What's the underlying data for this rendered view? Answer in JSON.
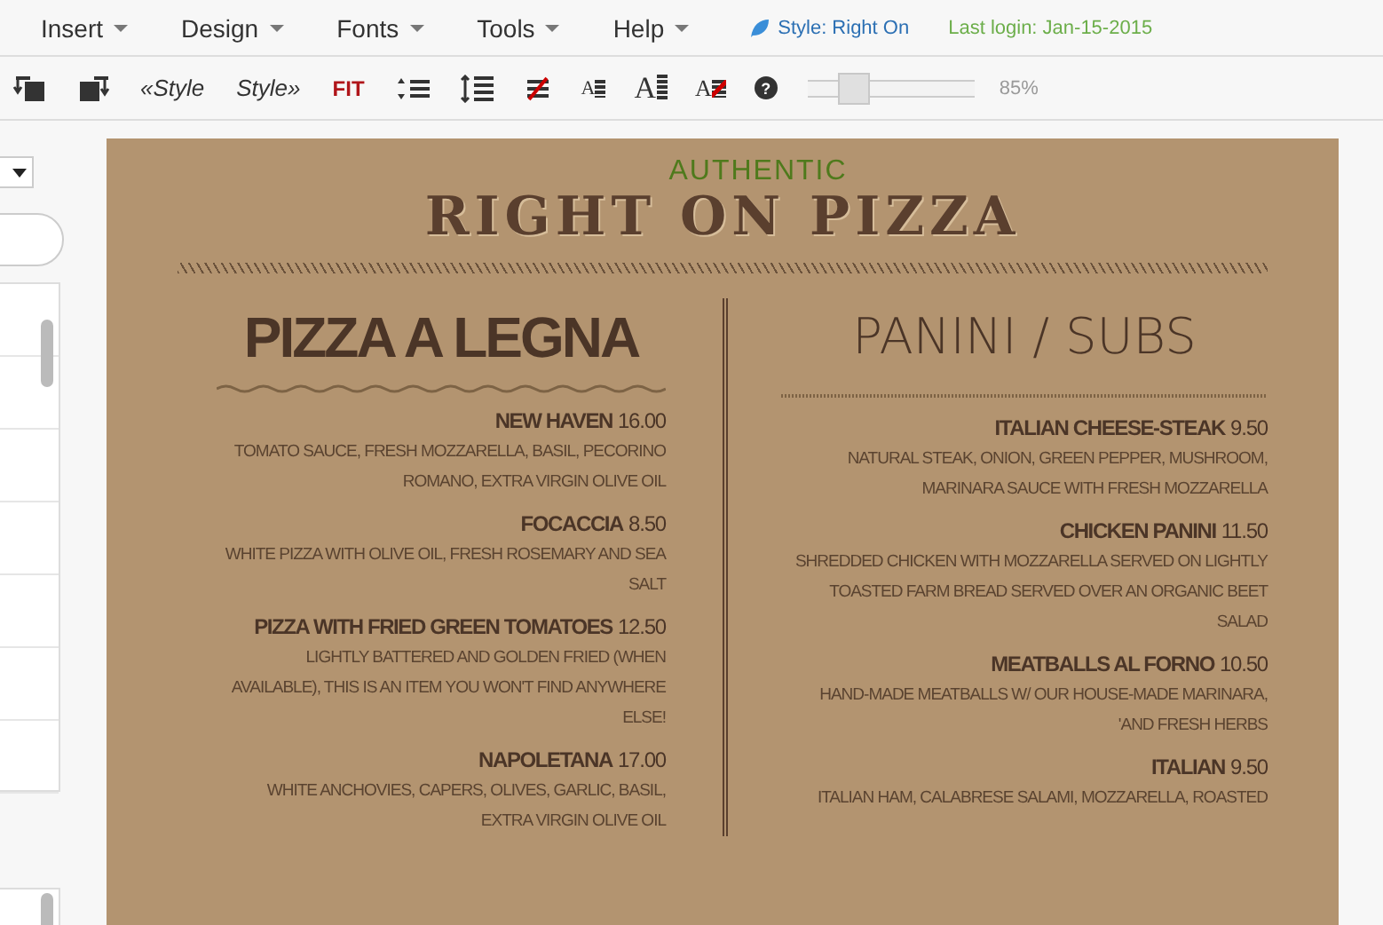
{
  "menu": [
    {
      "label": "Insert"
    },
    {
      "label": "Design"
    },
    {
      "label": "Fonts"
    },
    {
      "label": "Tools"
    },
    {
      "label": "Help"
    }
  ],
  "style_label": "Style: Right On",
  "last_login": "Last login: Jan-15-2015",
  "toolbar": {
    "style_prev": "«Style",
    "style_next": "Style»",
    "fit": "FIT",
    "letters": [
      "A",
      "A",
      "A"
    ],
    "help": "?"
  },
  "zoom": {
    "level": 0.28,
    "reading": "85%"
  },
  "menu_doc": {
    "tagline": "AUTHENTIC",
    "title": "RIGHT ON PIZZA",
    "sections": [
      {
        "heading": "PIZZA A LEGNA",
        "bold": true,
        "items": [
          {
            "name": "NEW HAVEN",
            "price": "16.00",
            "description": "TOMATO SAUCE, FRESH MOZZARELLA, BASIL, PECORINO ROMANO, EXTRA VIRGIN OLIVE OIL"
          },
          {
            "name": "FOCACCIA",
            "price": "8.50",
            "description": "WHITE PIZZA WITH OLIVE OIL, FRESH ROSEMARY AND SEA SALT"
          },
          {
            "name": "PIZZA WITH FRIED GREEN TOMATOES",
            "price": "12.50",
            "description": "LIGHTLY BATTERED AND GOLDEN FRIED (WHEN AVAILABLE), THIS IS AN ITEM YOU WON'T FIND ANYWHERE ELSE!"
          },
          {
            "name": "NAPOLETANA",
            "price": "17.00",
            "description": "WHITE ANCHOVIES, CAPERS, OLIVES, GARLIC, BASIL, EXTRA VIRGIN OLIVE OIL"
          }
        ]
      },
      {
        "heading": "PANINI / SUBS",
        "bold": false,
        "items": [
          {
            "name": "ITALIAN CHEESE-STEAK",
            "price": "9.50",
            "description": "NATURAL STEAK, ONION, GREEN PEPPER, MUSHROOM, MARINARA SAUCE WITH FRESH MOZZARELLA"
          },
          {
            "name": "CHICKEN PANINI",
            "price": "11.50",
            "description": "SHREDDED CHICKEN WITH MOZZARELLA SERVED ON LIGHTLY TOASTED FARM BREAD SERVED OVER AN ORGANIC BEET SALAD"
          },
          {
            "name": "MEATBALLS AL FORNO",
            "price": "10.50",
            "description": "HAND-MADE MEATBALLS W/ OUR HOUSE-MADE MARINARA, 'AND FRESH HERBS"
          },
          {
            "name": "ITALIAN",
            "price": "9.50",
            "description": "ITALIAN HAM, CALABRESE SALAMI, MOZZARELLA, ROASTED"
          }
        ]
      }
    ]
  }
}
